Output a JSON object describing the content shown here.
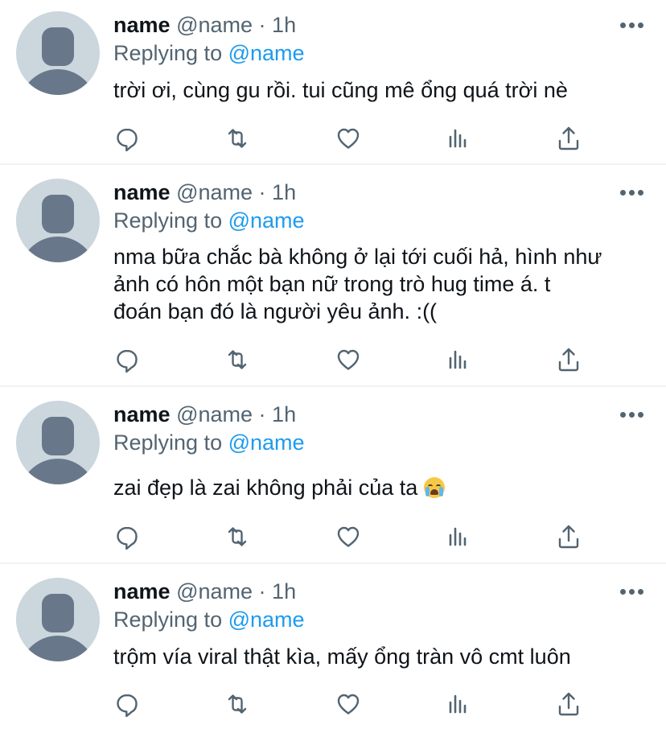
{
  "tweets": [
    {
      "name": "name",
      "handle": "@name",
      "separator": "·",
      "time": "1h",
      "replying_label": "Replying to",
      "replying_to": "@name",
      "text": "trời ơi, cùng gu rồi. tui cũng mê ổng quá trời nè"
    },
    {
      "name": "name",
      "handle": "@name",
      "separator": "·",
      "time": "1h",
      "replying_label": "Replying to",
      "replying_to": "@name",
      "text": "nma bữa chắc bà không ở lại tới cuối hả, hình như\nảnh có hôn một bạn nữ trong trò hug time á. t\nđoán bạn đó là người yêu ảnh. :(("
    },
    {
      "name": "name",
      "handle": "@name",
      "separator": "·",
      "time": "1h",
      "replying_label": "Replying to",
      "replying_to": "@name",
      "text": "zai đẹp là zai không phải của ta",
      "emoji": "loudly-crying-face"
    },
    {
      "name": "name",
      "handle": "@name",
      "separator": "·",
      "time": "1h",
      "replying_label": "Replying to",
      "replying_to": "@name",
      "text": "trộm vía viral thật kìa, mấy ổng tràn vô cmt luôn"
    }
  ],
  "icons": {
    "more": "more-horizontal-icon",
    "reply": "reply-icon",
    "retweet": "retweet-icon",
    "like": "like-heart-icon",
    "views": "views-chart-icon",
    "share": "share-icon"
  },
  "colors": {
    "text": "#0f1419",
    "secondary": "#536471",
    "mention": "#1d9bf0",
    "avatar_bg": "#ccd6dd",
    "avatar_fg": "#68788a",
    "divider": "#eff3f4"
  }
}
